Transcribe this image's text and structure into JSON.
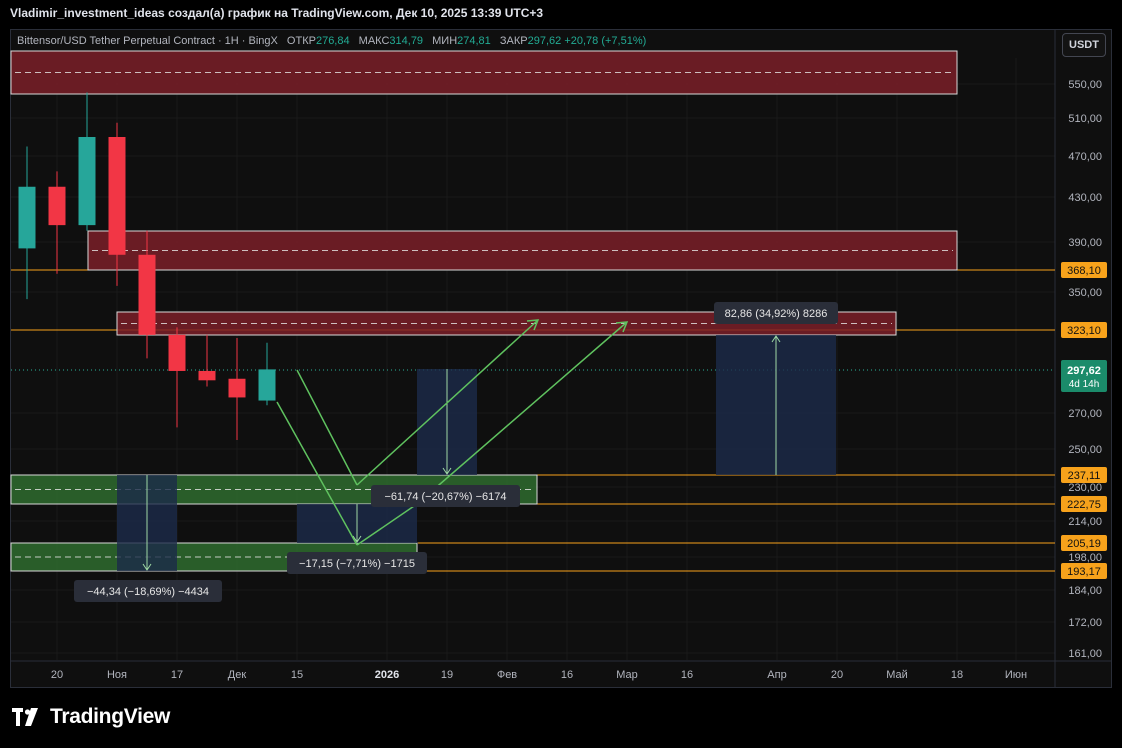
{
  "header": {
    "caption": "Vladimir_investment_ideas создал(а) график на TradingView.com, Дек 10, 2025 13:39 UTC+3"
  },
  "legend": {
    "symbol": "Bittensor/USD Tether Perpetual Contract · 1Н · BingX",
    "open_label": "ОТКР",
    "open": "276,84",
    "high_label": "МАКС",
    "high": "314,79",
    "low_label": "МИН",
    "low": "274,81",
    "close_label": "ЗАКР",
    "close": "297,62",
    "change": "+20,78 (+7,51%)"
  },
  "currency_button": "USDT",
  "brand": {
    "name": "TradingView"
  },
  "chart_data": {
    "type": "candlestick",
    "title": "Bittensor/USD Tether Perpetual Contract · 1Н · BingX",
    "x_ticks": [
      "20",
      "Ноя",
      "17",
      "Дек",
      "15",
      "2026",
      "19",
      "Фев",
      "16",
      "Мар",
      "16",
      "Апр",
      "20",
      "Май",
      "18",
      "Июн"
    ],
    "y_ticks": [
      "550,00",
      "510,00",
      "470,00",
      "430,00",
      "390,00",
      "350,00",
      "270,00",
      "250,00",
      "230,00",
      "214,00",
      "198,00",
      "184,00",
      "172,00",
      "161,00"
    ],
    "candles": [
      {
        "open": 385,
        "high": 480,
        "low": 345,
        "close": 440
      },
      {
        "open": 440,
        "high": 455,
        "low": 365,
        "close": 405
      },
      {
        "open": 405,
        "high": 540,
        "low": 400,
        "close": 490
      },
      {
        "open": 490,
        "high": 505,
        "low": 355,
        "close": 380
      },
      {
        "open": 380,
        "high": 400,
        "low": 305,
        "close": 320
      },
      {
        "open": 320,
        "high": 325,
        "low": 262,
        "close": 297
      },
      {
        "open": 297,
        "high": 320,
        "low": 287,
        "close": 291
      },
      {
        "open": 292,
        "high": 318,
        "low": 255,
        "close": 280
      },
      {
        "open": 278,
        "high": 315,
        "low": 275,
        "close": 298
      }
    ],
    "price_badges": [
      {
        "label": "368,10",
        "kind": "level"
      },
      {
        "label": "323,10",
        "kind": "level"
      },
      {
        "label": "297,62",
        "sub": "4d 14h",
        "kind": "current"
      },
      {
        "label": "237,11",
        "kind": "level"
      },
      {
        "label": "222,75",
        "kind": "level"
      },
      {
        "label": "205,19",
        "kind": "level"
      },
      {
        "label": "193,17",
        "kind": "level"
      }
    ],
    "measurement_labels": [
      "82,86 (34,92%) 8286",
      "−61,74 (−20,67%) −6174",
      "−17,15 (−7,71%) −1715",
      "−44,34 (−18,69%) −4434"
    ],
    "colors": {
      "up": "#26a69a",
      "down": "#f23645",
      "resistance_zone": "#7a1f28",
      "support_zone": "#2e6b2e",
      "level_line": "#f7a21b",
      "projection": "#5fc25f",
      "measure_box": "#1c2a4a",
      "current_price": "#1b8b6a"
    }
  }
}
